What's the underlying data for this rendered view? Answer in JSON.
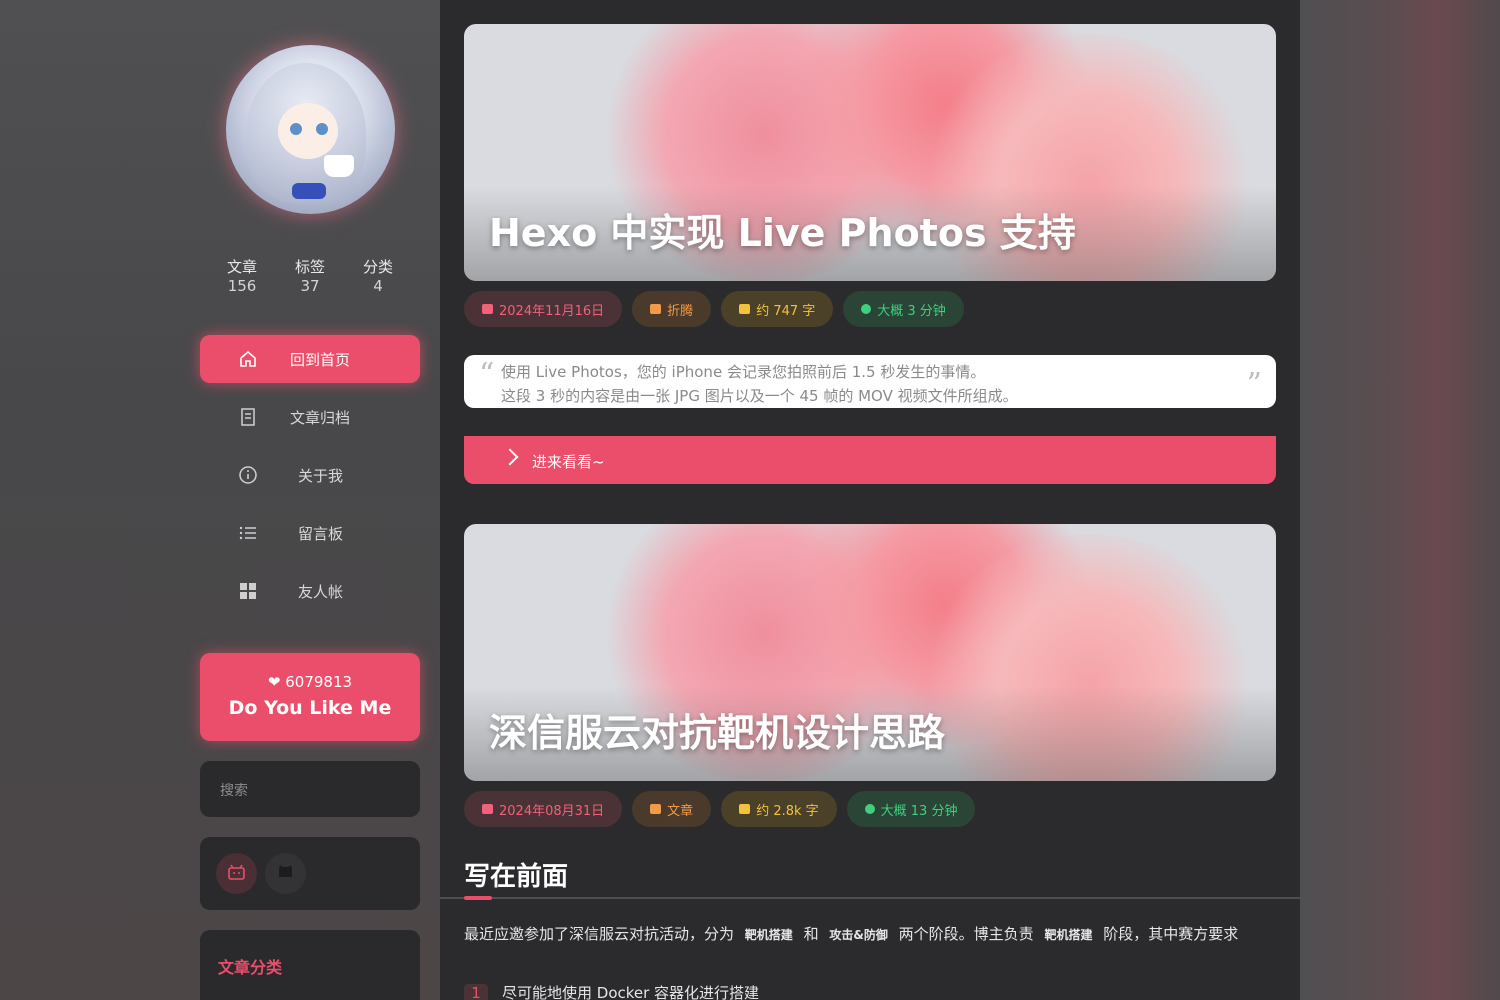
{
  "sidebar": {
    "stats": [
      {
        "label": "文章",
        "value": "156"
      },
      {
        "label": "标签",
        "value": "37"
      },
      {
        "label": "分类",
        "value": "4"
      }
    ],
    "menu": [
      {
        "label": "回到首页",
        "icon": "home-icon"
      },
      {
        "label": "文章归档",
        "icon": "archive-icon"
      },
      {
        "label": "关于我",
        "icon": "info-icon"
      },
      {
        "label": "留言板",
        "icon": "list-icon"
      },
      {
        "label": "友人帐",
        "icon": "grid-icon"
      }
    ],
    "like": {
      "count": "❤ 6079813",
      "text": "Do You Like Me"
    },
    "search_placeholder": "搜索",
    "social": [
      "bilibili-icon",
      "github-icon"
    ],
    "categories_title": "文章分类"
  },
  "posts": [
    {
      "title": "Hexo 中实现 Live Photos 支持",
      "date": "2024年11月16日",
      "category": "折腾",
      "words": "约 747 字",
      "read_time": "大概 3 分钟",
      "excerpt_line1": "使用 Live Photos，您的 iPhone 会记录您拍照前后 1.5 秒发生的事情。",
      "excerpt_line2": "这段 3 秒的内容是由一张 JPG 图片以及一个 45 帧的 MOV 视频文件所组成。",
      "read_more": "进来看看~"
    },
    {
      "title": "深信服云对抗靶机设计思路",
      "date": "2024年08月31日",
      "category": "文章",
      "words": "约 2.8k 字",
      "read_time": "大概 13 分钟"
    }
  ],
  "article": {
    "heading": "写在前面",
    "para_a": "最近应邀参加了深信服云对抗活动，分为",
    "tag_1": "靶机搭建",
    "para_b": "和",
    "tag_2": "攻击&防御",
    "para_c": "两个阶段。博主负责",
    "tag_3": "靶机搭建",
    "para_d": "阶段，其中赛方要求",
    "list_num": "1",
    "list_text": "尽可能地使用 Docker 容器化进行搭建"
  },
  "colors": {
    "accent": "#ea4e6a",
    "date": "#f2607a",
    "category": "#f39a48",
    "words": "#f3c23a",
    "time": "#3fd07e"
  }
}
